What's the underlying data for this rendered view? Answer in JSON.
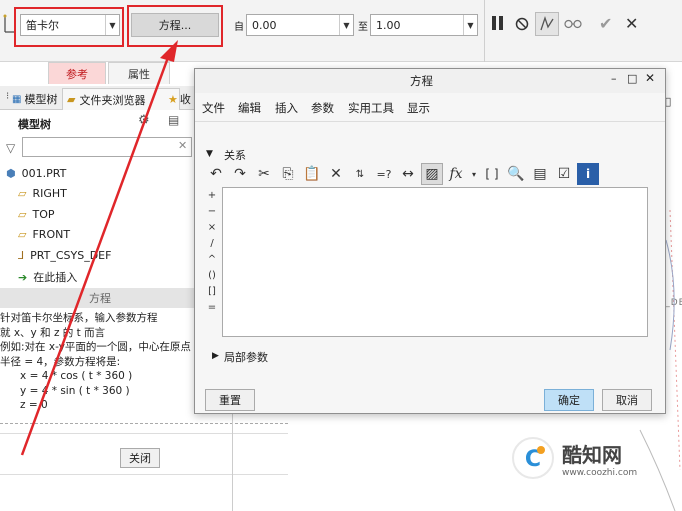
{
  "ribbon": {
    "coord_type": "笛卡尔",
    "equation_button": "方程...",
    "from_label": "自",
    "from_value": "0.00",
    "to_label": "至",
    "to_value": "1.00",
    "tabs": [
      "参考",
      "属性"
    ]
  },
  "left_panel": {
    "tabs": [
      "模型树",
      "文件夹浏览器",
      "收"
    ],
    "model_tree_label": "模型树",
    "tree_items": [
      "001.PRT",
      "RIGHT",
      "TOP",
      "FRONT",
      "PRT_CSYS_DEF",
      "在此插入"
    ],
    "info_title": "方程",
    "info_lines": [
      "针对笛卡尔坐标系，输入参数方程",
      "就 x、y 和 z 的 t 而言",
      "例如:对在 x-y平面的一个圆，中心在原点",
      "半径 = 4，参数方程将是:",
      "      x = 4 * cos ( t * 360 )",
      "      y = 4 * sin ( t * 360 )",
      "      z = 0"
    ],
    "close_button": "关闭"
  },
  "dialog": {
    "title": "方程",
    "menu": [
      "文件",
      "编辑",
      "插入",
      "参数",
      "实用工具",
      "显示"
    ],
    "relations_label": "关系",
    "side_buttons": [
      "+",
      "−",
      "×",
      "/",
      "^",
      "()",
      "[]",
      "="
    ],
    "local_params_label": "局部参数",
    "reset_button": "重置",
    "ok_button": "确定",
    "cancel_button": "取消"
  },
  "background": {
    "canvas_fragment": "YS_DE"
  },
  "watermark": {
    "brand": "酷知网",
    "url": "www.coozhi.com"
  },
  "colors": {
    "highlight_red": "#e0262a",
    "primary_button": "#bfe0f7"
  }
}
